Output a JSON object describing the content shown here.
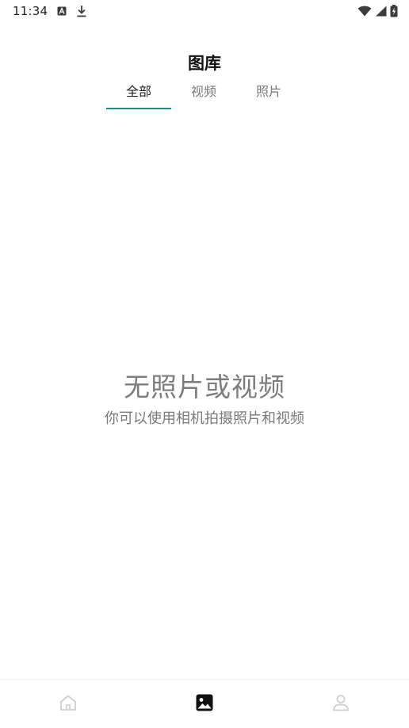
{
  "status_bar": {
    "time": "11:34",
    "icons": [
      "text-notification-icon",
      "download-icon",
      "wifi-icon",
      "cellular-signal-icon",
      "battery-charging-icon"
    ]
  },
  "header": {
    "title": "图库"
  },
  "tabs": [
    {
      "label": "全部",
      "active": true
    },
    {
      "label": "视频",
      "active": false
    },
    {
      "label": "照片",
      "active": false
    }
  ],
  "empty_state": {
    "title": "无照片或视频",
    "description": "你可以使用相机拍摄照片和视频"
  },
  "bottom_nav": {
    "items": [
      {
        "icon": "home-icon",
        "active": false
      },
      {
        "icon": "gallery-icon",
        "active": true
      },
      {
        "icon": "profile-icon",
        "active": false
      }
    ]
  },
  "colors": {
    "accent": "#1e8a80",
    "inactive_icon": "#cfcfcf",
    "active_icon": "#111111",
    "muted_text": "#7a7a7a"
  }
}
